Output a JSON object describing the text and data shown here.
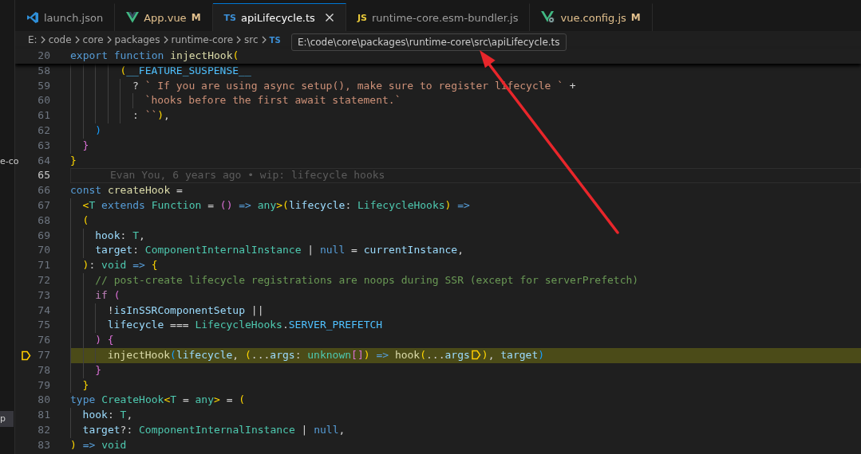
{
  "sidebar": {
    "fragments": [
      {
        "text": "e-co",
        "selected": false
      },
      {
        "text": "p",
        "selected": true
      }
    ]
  },
  "tabs": [
    {
      "label": "launch.json",
      "icon": {
        "kind": "vscode"
      },
      "modified": false,
      "selected": false
    },
    {
      "label": "App.vue",
      "icon": {
        "kind": "vue"
      },
      "modified": true,
      "badge": "M",
      "selected": false
    },
    {
      "label": "apiLifecycle.ts",
      "icon": {
        "kind": "text",
        "text": "TS",
        "color": "#3c8fd6"
      },
      "modified": false,
      "selected": true
    },
    {
      "label": "runtime-core.esm-bundler.js",
      "icon": {
        "kind": "text",
        "text": "JS",
        "color": "#e8c93a"
      },
      "modified": false,
      "selected": false
    },
    {
      "label": "vue.config.js",
      "icon": {
        "kind": "vueconfig"
      },
      "modified": true,
      "badge": "M",
      "selected": false
    }
  ],
  "breadcrumbs": {
    "items": [
      "E:",
      "code",
      "core",
      "packages",
      "runtime-core",
      "src"
    ],
    "file_icon": "TS"
  },
  "tooltip": "E:\\code\\core\\packages\\runtime-core\\src\\apiLifecycle.ts",
  "editor": {
    "lines": [
      {
        "number": "20",
        "sticky": true,
        "tokens": [
          {
            "text": "export function",
            "kind": "kw"
          },
          {
            "text": " injectHook",
            "kind": "fn"
          },
          {
            "text": "(",
            "kind": "b1"
          }
        ]
      },
      {
        "number": "58",
        "tokens": [
          {
            "text": "        (",
            "kind": "b1"
          },
          {
            "text": "__FEATURE_SUSPENSE__",
            "kind": "const"
          }
        ]
      },
      {
        "number": "59",
        "tokens": [
          {
            "text": "          ? ",
            "kind": "op"
          },
          {
            "text": "` If you are using async setup(), make sure to register lifecycle `",
            "kind": "str"
          },
          {
            "text": " +",
            "kind": "op"
          }
        ]
      },
      {
        "number": "60",
        "tokens": [
          {
            "text": "            `hooks before the first await statement.`",
            "kind": "str"
          }
        ]
      },
      {
        "number": "61",
        "tokens": [
          {
            "text": "          : ",
            "kind": "op"
          },
          {
            "text": "``",
            "kind": "str"
          },
          {
            "text": ")",
            "kind": "b1"
          },
          {
            "text": ",",
            "kind": "op"
          }
        ]
      },
      {
        "number": "62",
        "tokens": [
          {
            "text": "    )",
            "kind": "b3"
          }
        ]
      },
      {
        "number": "63",
        "tokens": [
          {
            "text": "  }",
            "kind": "b2"
          }
        ]
      },
      {
        "number": "64",
        "tokens": [
          {
            "text": "}",
            "kind": "b1"
          }
        ]
      },
      {
        "number": "65",
        "current": true,
        "blame": "Evan You, 6 years ago • wip: lifecycle hooks"
      },
      {
        "number": "66",
        "tokens": [
          {
            "text": "const",
            "kind": "kw"
          },
          {
            "text": " createHook",
            "kind": "fn"
          },
          {
            "text": " =",
            "kind": "op"
          }
        ]
      },
      {
        "number": "67",
        "tokens": [
          {
            "text": "  <",
            "kind": "b1"
          },
          {
            "text": "T",
            "kind": "type"
          },
          {
            "text": " extends ",
            "kind": "kw"
          },
          {
            "text": "Function",
            "kind": "type"
          },
          {
            "text": " = ",
            "kind": "op"
          },
          {
            "text": "()",
            "kind": "b2"
          },
          {
            "text": " => ",
            "kind": "kw"
          },
          {
            "text": "any",
            "kind": "type"
          },
          {
            "text": ">",
            "kind": "b1"
          },
          {
            "text": "(",
            "kind": "b1"
          },
          {
            "text": "lifecycle",
            "kind": "var"
          },
          {
            "text": ": ",
            "kind": "op"
          },
          {
            "text": "LifecycleHooks",
            "kind": "type"
          },
          {
            "text": ")",
            "kind": "b1"
          },
          {
            "text": " =>",
            "kind": "kw"
          }
        ]
      },
      {
        "number": "68",
        "tokens": [
          {
            "text": "  (",
            "kind": "b1"
          }
        ]
      },
      {
        "number": "69",
        "tokens": [
          {
            "text": "    hook",
            "kind": "var"
          },
          {
            "text": ": ",
            "kind": "op"
          },
          {
            "text": "T",
            "kind": "type"
          },
          {
            "text": ",",
            "kind": "op"
          }
        ]
      },
      {
        "number": "70",
        "tokens": [
          {
            "text": "    target",
            "kind": "var"
          },
          {
            "text": ": ",
            "kind": "op"
          },
          {
            "text": "ComponentInternalInstance",
            "kind": "type"
          },
          {
            "text": " | ",
            "kind": "op"
          },
          {
            "text": "null",
            "kind": "kw"
          },
          {
            "text": " = ",
            "kind": "op"
          },
          {
            "text": "currentInstance",
            "kind": "var"
          },
          {
            "text": ",",
            "kind": "op"
          }
        ]
      },
      {
        "number": "71",
        "tokens": [
          {
            "text": "  )",
            "kind": "b1"
          },
          {
            "text": ": ",
            "kind": "op"
          },
          {
            "text": "void",
            "kind": "type"
          },
          {
            "text": " => ",
            "kind": "kw"
          },
          {
            "text": "{",
            "kind": "b1"
          }
        ]
      },
      {
        "number": "72",
        "tokens": [
          {
            "text": "    // post-create lifecycle registrations are noops during SSR (except for serverPrefetch)",
            "kind": "comment"
          }
        ]
      },
      {
        "number": "73",
        "tokens": [
          {
            "text": "    if",
            "kind": "ctrl"
          },
          {
            "text": " (",
            "kind": "b2"
          }
        ]
      },
      {
        "number": "74",
        "tokens": [
          {
            "text": "      !",
            "kind": "op"
          },
          {
            "text": "isInSSRComponentSetup",
            "kind": "var"
          },
          {
            "text": " ||",
            "kind": "op"
          }
        ]
      },
      {
        "number": "75",
        "tokens": [
          {
            "text": "      lifecycle",
            "kind": "var"
          },
          {
            "text": " === ",
            "kind": "op"
          },
          {
            "text": "LifecycleHooks",
            "kind": "type"
          },
          {
            "text": ".",
            "kind": "op"
          },
          {
            "text": "SERVER_PREFETCH",
            "kind": "const"
          }
        ]
      },
      {
        "number": "76",
        "tokens": [
          {
            "text": "    ) {",
            "kind": "b2"
          }
        ]
      },
      {
        "number": "77",
        "paused": true,
        "tokens": [
          {
            "text": "      injectHook",
            "kind": "fn"
          },
          {
            "text": "(",
            "kind": "b3"
          },
          {
            "text": "lifecycle",
            "kind": "var"
          },
          {
            "text": ", ",
            "kind": "op"
          },
          {
            "text": "(",
            "kind": "b1"
          },
          {
            "text": "...",
            "kind": "op"
          },
          {
            "text": "args",
            "kind": "var"
          },
          {
            "text": ": ",
            "kind": "op"
          },
          {
            "text": "unknown",
            "kind": "type"
          },
          {
            "text": "[]",
            "kind": "b2"
          },
          {
            "text": ")",
            "kind": "b1"
          },
          {
            "text": " => ",
            "kind": "kw"
          },
          {
            "text": "hook",
            "kind": "fn"
          },
          {
            "text": "(",
            "kind": "b1"
          },
          {
            "text": "...",
            "kind": "op"
          },
          {
            "text": "args",
            "kind": "var"
          }
        ],
        "inline_breakpoint": true,
        "rest": [
          {
            "text": ")",
            "kind": "b1"
          },
          {
            "text": ", ",
            "kind": "op"
          },
          {
            "text": "target",
            "kind": "var"
          },
          {
            "text": ")",
            "kind": "b3"
          }
        ]
      },
      {
        "number": "78",
        "tokens": [
          {
            "text": "    }",
            "kind": "b2"
          }
        ]
      },
      {
        "number": "79",
        "tokens": [
          {
            "text": "  }",
            "kind": "b1"
          }
        ]
      },
      {
        "number": "80",
        "tokens": [
          {
            "text": "type",
            "kind": "kw"
          },
          {
            "text": " CreateHook",
            "kind": "type"
          },
          {
            "text": "<",
            "kind": "b1"
          },
          {
            "text": "T",
            "kind": "type"
          },
          {
            "text": " = ",
            "kind": "op"
          },
          {
            "text": "any",
            "kind": "type"
          },
          {
            "text": ">",
            "kind": "b1"
          },
          {
            "text": " = ",
            "kind": "op"
          },
          {
            "text": "(",
            "kind": "b1"
          }
        ]
      },
      {
        "number": "81",
        "tokens": [
          {
            "text": "  hook",
            "kind": "var"
          },
          {
            "text": ": ",
            "kind": "op"
          },
          {
            "text": "T",
            "kind": "type"
          },
          {
            "text": ",",
            "kind": "op"
          }
        ]
      },
      {
        "number": "82",
        "tokens": [
          {
            "text": "  target",
            "kind": "var"
          },
          {
            "text": "?: ",
            "kind": "op"
          },
          {
            "text": "ComponentInternalInstance",
            "kind": "type"
          },
          {
            "text": " | ",
            "kind": "op"
          },
          {
            "text": "null",
            "kind": "kw"
          },
          {
            "text": ",",
            "kind": "op"
          }
        ]
      },
      {
        "number": "83",
        "tokens": [
          {
            "text": ") ",
            "kind": "b1"
          },
          {
            "text": "=> ",
            "kind": "kw"
          },
          {
            "text": "void",
            "kind": "type"
          }
        ]
      }
    ]
  }
}
